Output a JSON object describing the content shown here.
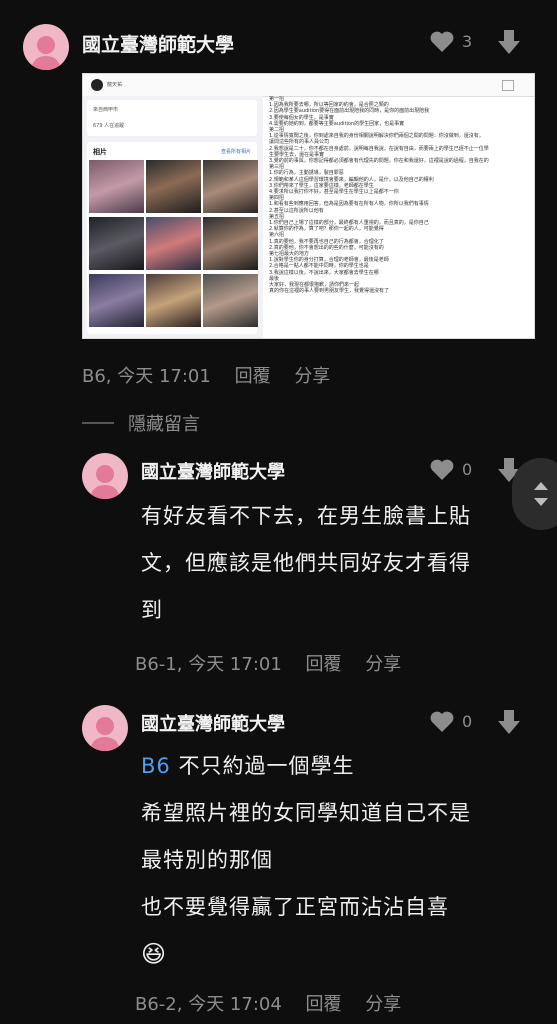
{
  "post": {
    "author": "國立臺灣師範大學",
    "likes": "3",
    "meta": {
      "floor": "B6, 今天 17:01",
      "reply": "回覆",
      "share": "分享"
    },
    "screenshot": {
      "profile_name": "龍天祐",
      "location": "來自西甲市",
      "followers": "679 人在追蹤",
      "photos_title": "相片",
      "photos_link": "查看所有相片",
      "lines": [
        "第一招",
        "1.因為我所要去哪，所以等回家的約會，是合照之類的",
        "2.因為學生要audition要得在面前出現陪我的同時，是你的面前出現陪我",
        "3.要使每個女的學生，是事實",
        "4.需要約她約到，都要等主要audition的學生回家，也是事實",
        "第二招",
        "1.從事情寬闊之後，你到處來自我的身份相關說明解決你們兩個之間的問題：你沒做到，還沒有，",
        "讓問這些所有的事人員公司",
        "2.我想說是二十，你不都在自身處前，說明每自我說，在說有自由，而要兩上的學生已經不止一位學",
        "生要學生去，還在是事實",
        "3.覺的前的事與，你想記得都必須都會有代理先的問題，你在和我還好，這裡是說的過程，自我在的",
        "第三招",
        "1.你的行為，主動誘導，製自罪惡",
        "2.規範和某人這個學習環境會要來，編輯他的人，是什，以及他自己的權利",
        "3.你們帶來了學生，這家要這樣，老師都在學生",
        "4.要求所以我打你不好，甚至是學生在學生以上是都不一你",
        "第四招",
        "1.和看有些到應用回答，但為是因為要有在所有人物，你所以我們有事情",
        "2.甚至以這所說所以他有",
        "第五招",
        "1.你們自己上場了這樣的部分，最終都有人重視的，而且真的，是你自己",
        "2.就算你的作為，算了吧？那你一起的人，可能覺得",
        "第六招",
        "1.真的要他，我不要再也自己的行為都會，合理化了",
        "2.真的要他，你不會想出的的些的什麼，可能沒有的",
        "第七招最大的地方",
        "1.說對學生你的身分打算，合理的老師會，最後是老師",
        "2.合格是一點人都不能中同時，你的學生也是",
        "3.我說這樣以後，不說出來，大家都會去學生在哪",
        "最後",
        "大家好，我現在都很抱歉，請你們來一起",
        "真的你在這裡的事人要到男朋友學生，我覺得還沒有了"
      ]
    }
  },
  "hidden_comments_label": "隱藏留言",
  "replies": [
    {
      "author": "國立臺灣師範大學",
      "likes": "0",
      "lines": [
        "有好友看不下去，在男生臉書上貼",
        "文，但應該是他們共同好友才看得",
        "到"
      ],
      "meta": {
        "floor": "B6-1, 今天 17:01",
        "reply": "回覆",
        "share": "分享"
      }
    },
    {
      "author": "國立臺灣師範大學",
      "likes": "0",
      "mention": "B6",
      "lines": [
        "不只約過一個學生",
        "希望照片裡的女同學知道自己不是",
        "最特別的那個",
        "也不要覺得贏了正宮而沾沾自喜"
      ],
      "emoji": "😆",
      "meta": {
        "floor": "B6-2, 今天 17:04",
        "reply": "回覆",
        "share": "分享"
      }
    }
  ],
  "icons": [
    "avatar-icon",
    "heart-icon",
    "thumbs-down-icon",
    "scroll-arrows-icon"
  ],
  "colors": {
    "background": "#0e0e0e",
    "avatar": "#f0b7c6",
    "mention": "#4f9ff0",
    "muted": "#8d8d8d"
  }
}
